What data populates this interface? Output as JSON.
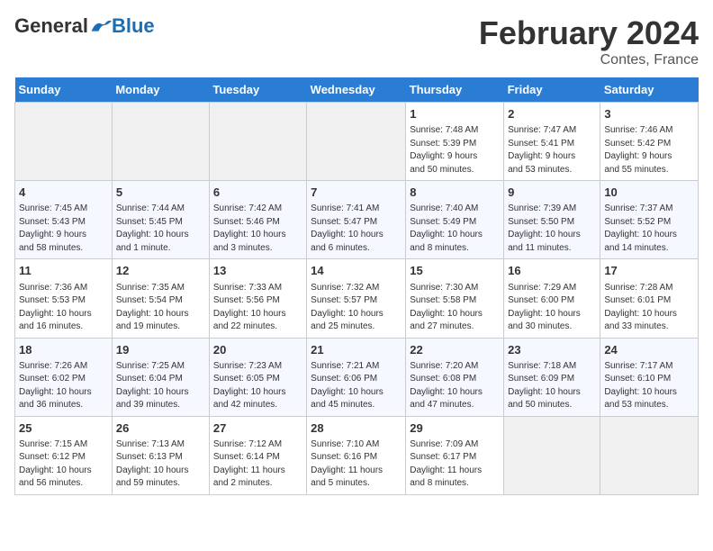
{
  "logo": {
    "general": "General",
    "blue": "Blue"
  },
  "title": "February 2024",
  "subtitle": "Contes, France",
  "days_of_week": [
    "Sunday",
    "Monday",
    "Tuesday",
    "Wednesday",
    "Thursday",
    "Friday",
    "Saturday"
  ],
  "weeks": [
    [
      {
        "day": "",
        "info": ""
      },
      {
        "day": "",
        "info": ""
      },
      {
        "day": "",
        "info": ""
      },
      {
        "day": "",
        "info": ""
      },
      {
        "day": "1",
        "info": "Sunrise: 7:48 AM\nSunset: 5:39 PM\nDaylight: 9 hours\nand 50 minutes."
      },
      {
        "day": "2",
        "info": "Sunrise: 7:47 AM\nSunset: 5:41 PM\nDaylight: 9 hours\nand 53 minutes."
      },
      {
        "day": "3",
        "info": "Sunrise: 7:46 AM\nSunset: 5:42 PM\nDaylight: 9 hours\nand 55 minutes."
      }
    ],
    [
      {
        "day": "4",
        "info": "Sunrise: 7:45 AM\nSunset: 5:43 PM\nDaylight: 9 hours\nand 58 minutes."
      },
      {
        "day": "5",
        "info": "Sunrise: 7:44 AM\nSunset: 5:45 PM\nDaylight: 10 hours\nand 1 minute."
      },
      {
        "day": "6",
        "info": "Sunrise: 7:42 AM\nSunset: 5:46 PM\nDaylight: 10 hours\nand 3 minutes."
      },
      {
        "day": "7",
        "info": "Sunrise: 7:41 AM\nSunset: 5:47 PM\nDaylight: 10 hours\nand 6 minutes."
      },
      {
        "day": "8",
        "info": "Sunrise: 7:40 AM\nSunset: 5:49 PM\nDaylight: 10 hours\nand 8 minutes."
      },
      {
        "day": "9",
        "info": "Sunrise: 7:39 AM\nSunset: 5:50 PM\nDaylight: 10 hours\nand 11 minutes."
      },
      {
        "day": "10",
        "info": "Sunrise: 7:37 AM\nSunset: 5:52 PM\nDaylight: 10 hours\nand 14 minutes."
      }
    ],
    [
      {
        "day": "11",
        "info": "Sunrise: 7:36 AM\nSunset: 5:53 PM\nDaylight: 10 hours\nand 16 minutes."
      },
      {
        "day": "12",
        "info": "Sunrise: 7:35 AM\nSunset: 5:54 PM\nDaylight: 10 hours\nand 19 minutes."
      },
      {
        "day": "13",
        "info": "Sunrise: 7:33 AM\nSunset: 5:56 PM\nDaylight: 10 hours\nand 22 minutes."
      },
      {
        "day": "14",
        "info": "Sunrise: 7:32 AM\nSunset: 5:57 PM\nDaylight: 10 hours\nand 25 minutes."
      },
      {
        "day": "15",
        "info": "Sunrise: 7:30 AM\nSunset: 5:58 PM\nDaylight: 10 hours\nand 27 minutes."
      },
      {
        "day": "16",
        "info": "Sunrise: 7:29 AM\nSunset: 6:00 PM\nDaylight: 10 hours\nand 30 minutes."
      },
      {
        "day": "17",
        "info": "Sunrise: 7:28 AM\nSunset: 6:01 PM\nDaylight: 10 hours\nand 33 minutes."
      }
    ],
    [
      {
        "day": "18",
        "info": "Sunrise: 7:26 AM\nSunset: 6:02 PM\nDaylight: 10 hours\nand 36 minutes."
      },
      {
        "day": "19",
        "info": "Sunrise: 7:25 AM\nSunset: 6:04 PM\nDaylight: 10 hours\nand 39 minutes."
      },
      {
        "day": "20",
        "info": "Sunrise: 7:23 AM\nSunset: 6:05 PM\nDaylight: 10 hours\nand 42 minutes."
      },
      {
        "day": "21",
        "info": "Sunrise: 7:21 AM\nSunset: 6:06 PM\nDaylight: 10 hours\nand 45 minutes."
      },
      {
        "day": "22",
        "info": "Sunrise: 7:20 AM\nSunset: 6:08 PM\nDaylight: 10 hours\nand 47 minutes."
      },
      {
        "day": "23",
        "info": "Sunrise: 7:18 AM\nSunset: 6:09 PM\nDaylight: 10 hours\nand 50 minutes."
      },
      {
        "day": "24",
        "info": "Sunrise: 7:17 AM\nSunset: 6:10 PM\nDaylight: 10 hours\nand 53 minutes."
      }
    ],
    [
      {
        "day": "25",
        "info": "Sunrise: 7:15 AM\nSunset: 6:12 PM\nDaylight: 10 hours\nand 56 minutes."
      },
      {
        "day": "26",
        "info": "Sunrise: 7:13 AM\nSunset: 6:13 PM\nDaylight: 10 hours\nand 59 minutes."
      },
      {
        "day": "27",
        "info": "Sunrise: 7:12 AM\nSunset: 6:14 PM\nDaylight: 11 hours\nand 2 minutes."
      },
      {
        "day": "28",
        "info": "Sunrise: 7:10 AM\nSunset: 6:16 PM\nDaylight: 11 hours\nand 5 minutes."
      },
      {
        "day": "29",
        "info": "Sunrise: 7:09 AM\nSunset: 6:17 PM\nDaylight: 11 hours\nand 8 minutes."
      },
      {
        "day": "",
        "info": ""
      },
      {
        "day": "",
        "info": ""
      }
    ]
  ]
}
